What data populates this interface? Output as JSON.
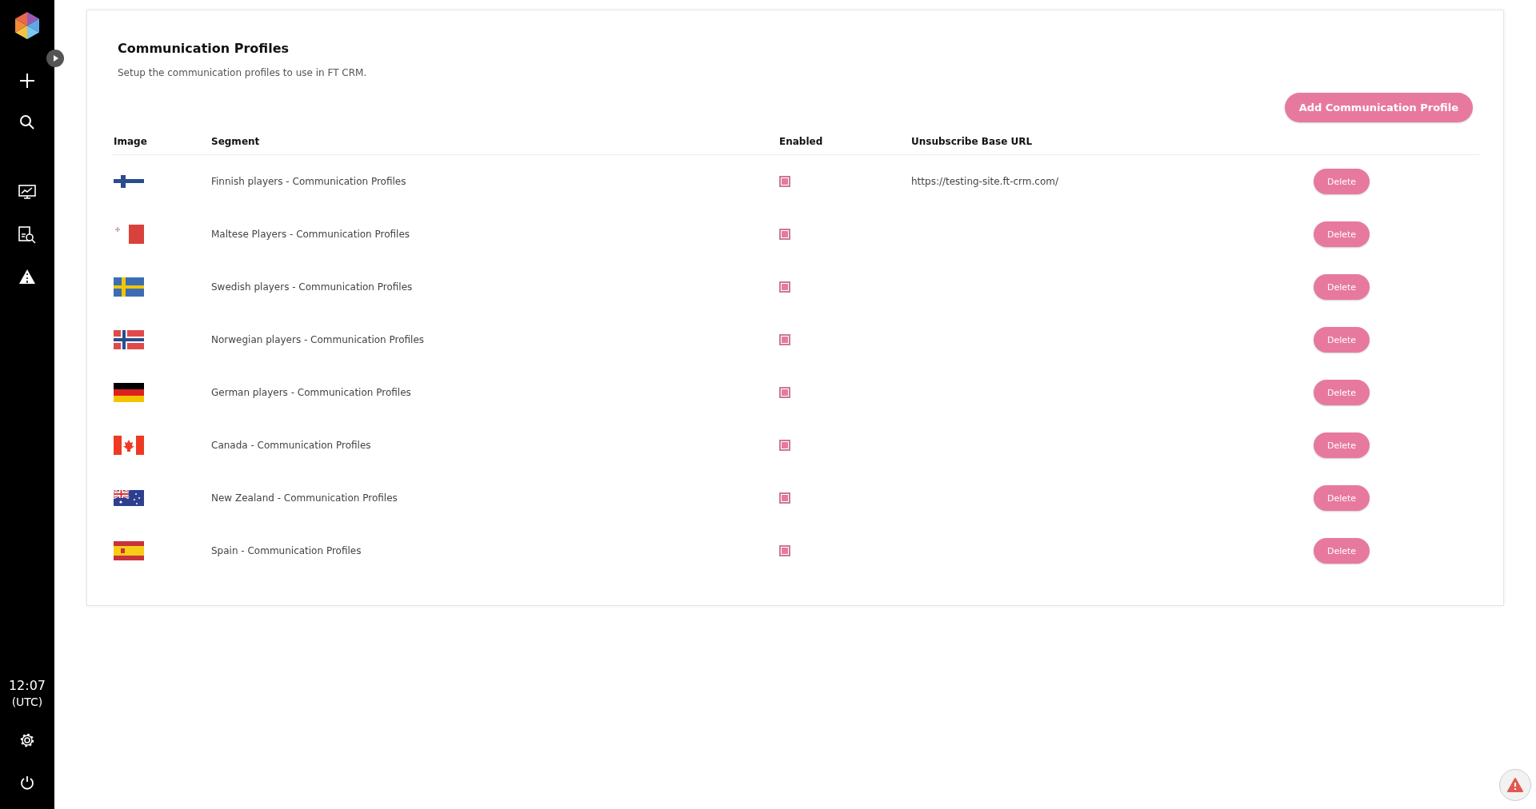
{
  "sidebar": {
    "clock": {
      "time": "12:07",
      "zone": "(UTC)"
    }
  },
  "page": {
    "title": "Communication Profiles",
    "subtitle": "Setup the communication profiles to use in FT CRM.",
    "add_button": "Add Communication Profile"
  },
  "table": {
    "columns": [
      "Image",
      "Segment",
      "Enabled",
      "Unsubscribe Base URL"
    ],
    "rows": [
      {
        "kind": "finland",
        "segment": "Finnish players - Communication Profiles",
        "enabled": true,
        "url": "https://testing-site.ft-crm.com/",
        "action": "Delete"
      },
      {
        "kind": "malta",
        "segment": "Maltese Players - Communication Profiles",
        "enabled": true,
        "action": "Delete"
      },
      {
        "kind": "sweden",
        "segment": "Swedish players - Communication Profiles",
        "enabled": true,
        "action": "Delete"
      },
      {
        "kind": "norway",
        "segment": "Norwegian players - Communication Profiles",
        "enabled": true,
        "action": "Delete"
      },
      {
        "kind": "germany",
        "segment": "German players - Communication Profiles",
        "enabled": true,
        "action": "Delete"
      },
      {
        "kind": "canada",
        "segment": "Canada - Communication Profiles",
        "enabled": true,
        "action": "Delete"
      },
      {
        "kind": "southern-cross",
        "segment": "New Zealand - Communication Profiles",
        "enabled": true,
        "action": "Delete"
      },
      {
        "kind": "spain",
        "segment": "Spain - Communication Profiles",
        "enabled": true,
        "action": "Delete"
      }
    ]
  }
}
